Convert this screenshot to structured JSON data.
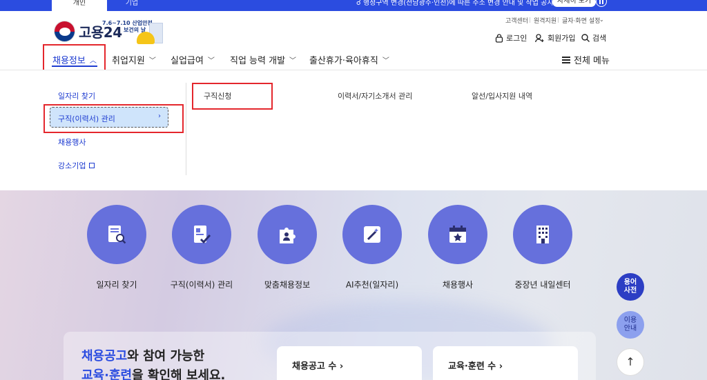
{
  "topbar": {
    "tab_personal": "개인",
    "tab_business": "기업",
    "notice": "☌ 행정구역 변경(전남광주·인천)에 따른 주소 변경 안내 및 작업 공지",
    "notice_button": "자세히 보기"
  },
  "header": {
    "logo_text": "고용24",
    "campaign_dates": "7.6~7.10 산업안전",
    "campaign_slogan": "보건의 날",
    "util": [
      "고객센터",
      "원격지원",
      "글자·화면 설정"
    ],
    "login": "로그인",
    "signup": "회원가입",
    "search": "검색"
  },
  "nav": {
    "items": [
      {
        "label": "채용정보",
        "chev": "^"
      },
      {
        "label": "취업지원",
        "chev": "v"
      },
      {
        "label": "실업급여",
        "chev": "v"
      },
      {
        "label": "직업 능력 개발",
        "chev": "v"
      },
      {
        "label": "출산휴가·육아휴직",
        "chev": "v"
      }
    ],
    "all_menu": "전체 메뉴"
  },
  "dropdown": {
    "left": [
      "일자리 찾기",
      "구직(이력서) 관리",
      "채용행사",
      "강소기업"
    ],
    "right": [
      "구직신청",
      "이력서/자기소개서 관리",
      "알선/입사지원 내역"
    ]
  },
  "quick_menu": [
    {
      "label": "일자리 찾기",
      "icon": "document-search-icon"
    },
    {
      "label": "구직(이력서) 관리",
      "icon": "resume-check-icon"
    },
    {
      "label": "맞춤채용정보",
      "icon": "puzzle-person-icon"
    },
    {
      "label": "AI추천(일자리)",
      "icon": "magic-wand-icon"
    },
    {
      "label": "채용행사",
      "icon": "calendar-star-icon"
    },
    {
      "label": "중장년 내일센터",
      "icon": "building-icon"
    }
  ],
  "side": {
    "glossary": "용어\n사전",
    "guide": "이용\n안내",
    "top": "↑"
  },
  "panel": {
    "title_hl1": "채용공고",
    "title_rest1": "와 참여 가능한",
    "title_hl2": "교육·훈련",
    "title_rest2": "을 확인해 보세요.",
    "card1": "채용공고 수 ›",
    "card2": "교육·훈련 수 ›"
  },
  "colors": {
    "brand_blue": "#2b4ce0",
    "quick_circle": "#6670dc",
    "highlight_red": "#e4262c"
  }
}
